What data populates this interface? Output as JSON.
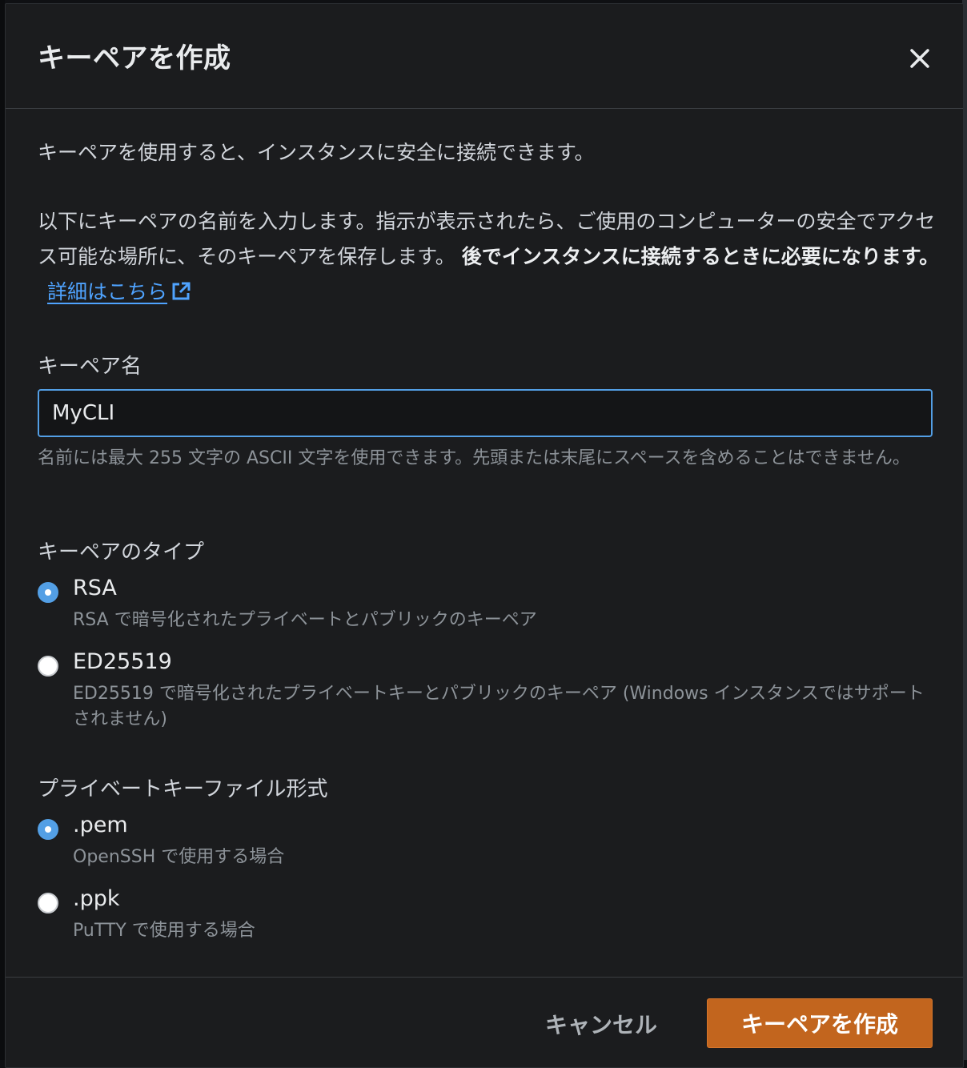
{
  "dialog": {
    "title": "キーペアを作成",
    "intro": "キーペアを使用すると、インスタンスに安全に接続できます。",
    "description_plain": "以下にキーペアの名前を入力します。指示が表示されたら、ご使用のコンピューターの安全でアクセス可能な場所に、そのキーペアを保存します。",
    "description_bold": "後でインスタンスに接続するときに必要になります。",
    "learn_more": "詳細はこちら"
  },
  "key_name": {
    "label": "キーペア名",
    "value": "MyCLI",
    "hint": "名前には最大 255 文字の ASCII 文字を使用できます。先頭または末尾にスペースを含めることはできません。"
  },
  "key_type": {
    "label": "キーペアのタイプ",
    "options": [
      {
        "label": "RSA",
        "description": "RSA で暗号化されたプライベートとパブリックのキーペア",
        "selected": true
      },
      {
        "label": "ED25519",
        "description": "ED25519 で暗号化されたプライベートキーとパブリックのキーペア (Windows インスタンスではサポートされません)",
        "selected": false
      }
    ]
  },
  "file_format": {
    "label": "プライベートキーファイル形式",
    "options": [
      {
        "label": ".pem",
        "description": "OpenSSH で使用する場合",
        "selected": true
      },
      {
        "label": ".ppk",
        "description": "PuTTY で使用する場合",
        "selected": false
      }
    ]
  },
  "footer": {
    "cancel_label": "キャンセル",
    "create_label": "キーペアを作成"
  },
  "colors": {
    "accent": "#539fe5",
    "primary_button": "#c2651e",
    "link": "#4fa3ff"
  },
  "icons": [
    "close-icon",
    "external-link-icon"
  ]
}
